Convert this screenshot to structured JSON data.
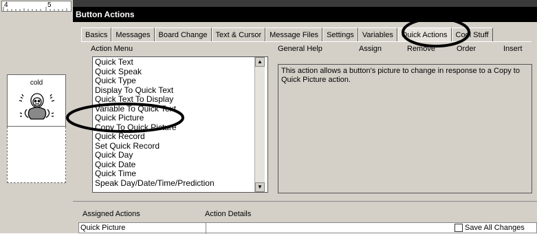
{
  "ruler": {
    "marks": [
      "4",
      "5"
    ]
  },
  "symbol": {
    "label": "cold"
  },
  "dialog": {
    "title": "Button Actions",
    "tabs": [
      "Basics",
      "Messages",
      "Board Change",
      "Text & Cursor",
      "Message Files",
      "Settings",
      "Variables",
      "Quick Actions",
      "Cool Stuff"
    ],
    "active_tab": "Quick Actions",
    "action_menu": {
      "label": "Action Menu",
      "items": [
        "Quick Text",
        "Quick Speak",
        "Quick Type",
        "Display To Quick Text",
        "Quick Text To Display",
        "Variable To Quick Text",
        "Quick Picture",
        "Copy To Quick Picture",
        "Quick Record",
        "Set Quick Record",
        "Quick Day",
        "Quick Date",
        "Quick Time",
        "Speak Day/Date/Time/Prediction"
      ],
      "highlighted": "Quick Picture"
    },
    "toolbar": {
      "general_help": "General Help",
      "assign": "Assign",
      "remove": "Remove",
      "order": "Order",
      "insert": "Insert"
    },
    "help_text": "This action allows a button's picture to change in response to a Copy to Quick Picture action.",
    "assigned_actions": {
      "label": "Assigned Actions",
      "details_label": "Action Details",
      "value": "Quick Picture",
      "save_all_label": "Save All Changes"
    }
  }
}
